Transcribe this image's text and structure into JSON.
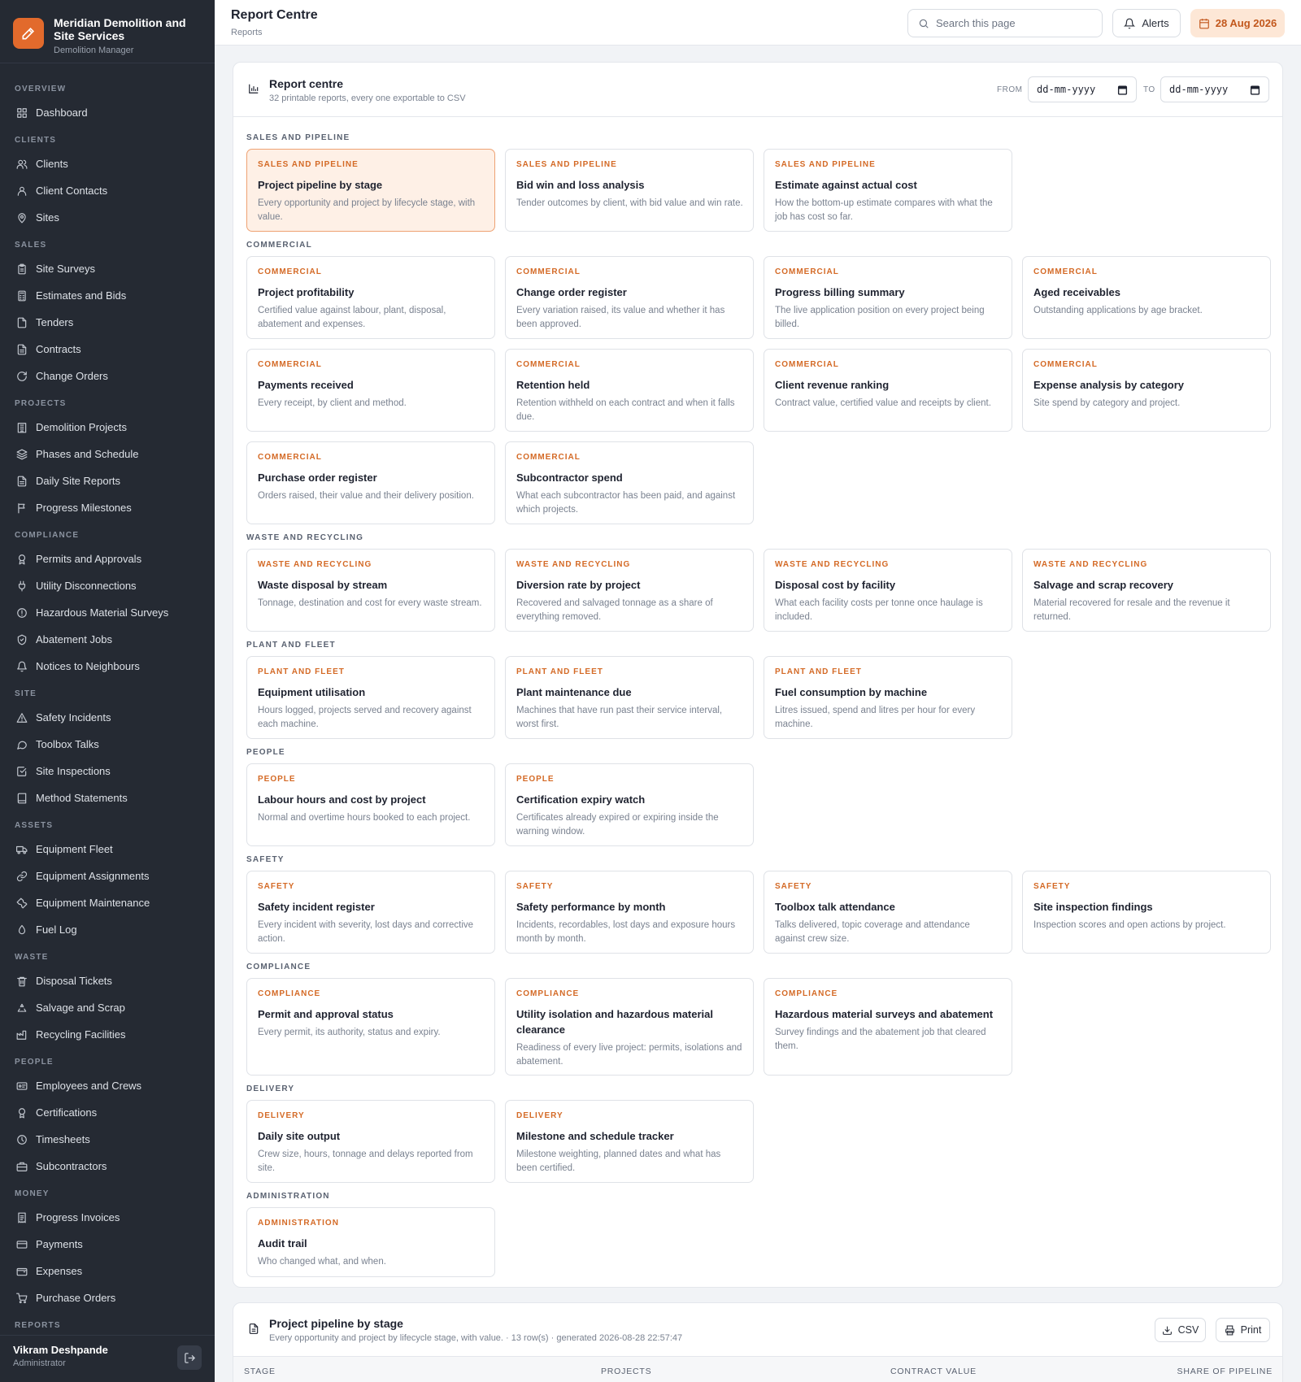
{
  "app": {
    "brand_name": "Meridian Demolition and Site Services",
    "brand_sub": "Demolition Manager"
  },
  "sidebar": {
    "groups": [
      {
        "label": "OVERVIEW",
        "items": [
          {
            "label": "Dashboard",
            "icon": "grid-icon"
          }
        ]
      },
      {
        "label": "CLIENTS",
        "items": [
          {
            "label": "Clients",
            "icon": "users-icon"
          },
          {
            "label": "Client Contacts",
            "icon": "user-icon"
          },
          {
            "label": "Sites",
            "icon": "map-pin-icon"
          }
        ]
      },
      {
        "label": "SALES",
        "items": [
          {
            "label": "Site Surveys",
            "icon": "clipboard-icon"
          },
          {
            "label": "Estimates and Bids",
            "icon": "calculator-icon"
          },
          {
            "label": "Tenders",
            "icon": "file-icon"
          },
          {
            "label": "Contracts",
            "icon": "file-text-icon"
          },
          {
            "label": "Change Orders",
            "icon": "refresh-icon"
          }
        ]
      },
      {
        "label": "PROJECTS",
        "items": [
          {
            "label": "Demolition Projects",
            "icon": "building-icon"
          },
          {
            "label": "Phases and Schedule",
            "icon": "layers-icon"
          },
          {
            "label": "Daily Site Reports",
            "icon": "file-text-icon"
          },
          {
            "label": "Progress Milestones",
            "icon": "flag-icon"
          }
        ]
      },
      {
        "label": "COMPLIANCE",
        "items": [
          {
            "label": "Permits and Approvals",
            "icon": "award-icon"
          },
          {
            "label": "Utility Disconnections",
            "icon": "plug-icon"
          },
          {
            "label": "Hazardous Material Surveys",
            "icon": "alert-circle-icon"
          },
          {
            "label": "Abatement Jobs",
            "icon": "shield-icon"
          },
          {
            "label": "Notices to Neighbours",
            "icon": "bell-icon"
          }
        ]
      },
      {
        "label": "SITE",
        "items": [
          {
            "label": "Safety Incidents",
            "icon": "alert-triangle-icon"
          },
          {
            "label": "Toolbox Talks",
            "icon": "message-icon"
          },
          {
            "label": "Site Inspections",
            "icon": "check-square-icon"
          },
          {
            "label": "Method Statements",
            "icon": "book-icon"
          }
        ]
      },
      {
        "label": "ASSETS",
        "items": [
          {
            "label": "Equipment Fleet",
            "icon": "truck-icon"
          },
          {
            "label": "Equipment Assignments",
            "icon": "link-icon"
          },
          {
            "label": "Equipment Maintenance",
            "icon": "wrench-icon"
          },
          {
            "label": "Fuel Log",
            "icon": "droplet-icon"
          }
        ]
      },
      {
        "label": "WASTE",
        "items": [
          {
            "label": "Disposal Tickets",
            "icon": "trash-icon"
          },
          {
            "label": "Salvage and Scrap",
            "icon": "recycle-icon"
          },
          {
            "label": "Recycling Facilities",
            "icon": "factory-icon"
          }
        ]
      },
      {
        "label": "PEOPLE",
        "items": [
          {
            "label": "Employees and Crews",
            "icon": "id-card-icon"
          },
          {
            "label": "Certifications",
            "icon": "certificate-icon"
          },
          {
            "label": "Timesheets",
            "icon": "clock-icon"
          },
          {
            "label": "Subcontractors",
            "icon": "briefcase-icon"
          }
        ]
      },
      {
        "label": "MONEY",
        "items": [
          {
            "label": "Progress Invoices",
            "icon": "invoice-icon"
          },
          {
            "label": "Payments",
            "icon": "credit-card-icon"
          },
          {
            "label": "Expenses",
            "icon": "wallet-icon"
          },
          {
            "label": "Purchase Orders",
            "icon": "cart-icon"
          }
        ]
      },
      {
        "label": "REPORTS",
        "items": []
      }
    ],
    "user": {
      "name": "Vikram Deshpande",
      "role": "Administrator"
    }
  },
  "header": {
    "title": "Report Centre",
    "breadcrumb": "Reports",
    "search_placeholder": "Search this page",
    "alerts_label": "Alerts",
    "date": "28 Aug 2026"
  },
  "report_centre": {
    "title": "Report centre",
    "subtitle": "32 printable reports, every one exportable to CSV",
    "from_label": "FROM",
    "to_label": "TO",
    "date_placeholder": "dd-mm-yyyy",
    "sections": [
      {
        "title": "SALES AND PIPELINE",
        "cards": [
          {
            "category": "SALES AND PIPELINE",
            "title": "Project pipeline by stage",
            "desc": "Every opportunity and project by lifecycle stage, with value.",
            "active": true
          },
          {
            "category": "SALES AND PIPELINE",
            "title": "Bid win and loss analysis",
            "desc": "Tender outcomes by client, with bid value and win rate."
          },
          {
            "category": "SALES AND PIPELINE",
            "title": "Estimate against actual cost",
            "desc": "How the bottom-up estimate compares with what the job has cost so far."
          }
        ]
      },
      {
        "title": "COMMERCIAL",
        "cards": [
          {
            "category": "COMMERCIAL",
            "title": "Project profitability",
            "desc": "Certified value against labour, plant, disposal, abatement and expenses."
          },
          {
            "category": "COMMERCIAL",
            "title": "Change order register",
            "desc": "Every variation raised, its value and whether it has been approved."
          },
          {
            "category": "COMMERCIAL",
            "title": "Progress billing summary",
            "desc": "The live application position on every project being billed."
          },
          {
            "category": "COMMERCIAL",
            "title": "Aged receivables",
            "desc": "Outstanding applications by age bracket."
          },
          {
            "category": "COMMERCIAL",
            "title": "Payments received",
            "desc": "Every receipt, by client and method."
          },
          {
            "category": "COMMERCIAL",
            "title": "Retention held",
            "desc": "Retention withheld on each contract and when it falls due."
          },
          {
            "category": "COMMERCIAL",
            "title": "Client revenue ranking",
            "desc": "Contract value, certified value and receipts by client."
          },
          {
            "category": "COMMERCIAL",
            "title": "Expense analysis by category",
            "desc": "Site spend by category and project."
          },
          {
            "category": "COMMERCIAL",
            "title": "Purchase order register",
            "desc": "Orders raised, their value and their delivery position."
          },
          {
            "category": "COMMERCIAL",
            "title": "Subcontractor spend",
            "desc": "What each subcontractor has been paid, and against which projects."
          }
        ]
      },
      {
        "title": "WASTE AND RECYCLING",
        "cards": [
          {
            "category": "WASTE AND RECYCLING",
            "title": "Waste disposal by stream",
            "desc": "Tonnage, destination and cost for every waste stream."
          },
          {
            "category": "WASTE AND RECYCLING",
            "title": "Diversion rate by project",
            "desc": "Recovered and salvaged tonnage as a share of everything removed."
          },
          {
            "category": "WASTE AND RECYCLING",
            "title": "Disposal cost by facility",
            "desc": "What each facility costs per tonne once haulage is included."
          },
          {
            "category": "WASTE AND RECYCLING",
            "title": "Salvage and scrap recovery",
            "desc": "Material recovered for resale and the revenue it returned."
          }
        ]
      },
      {
        "title": "PLANT AND FLEET",
        "cards": [
          {
            "category": "PLANT AND FLEET",
            "title": "Equipment utilisation",
            "desc": "Hours logged, projects served and recovery against each machine."
          },
          {
            "category": "PLANT AND FLEET",
            "title": "Plant maintenance due",
            "desc": "Machines that have run past their service interval, worst first."
          },
          {
            "category": "PLANT AND FLEET",
            "title": "Fuel consumption by machine",
            "desc": "Litres issued, spend and litres per hour for every machine."
          }
        ]
      },
      {
        "title": "PEOPLE",
        "cards": [
          {
            "category": "PEOPLE",
            "title": "Labour hours and cost by project",
            "desc": "Normal and overtime hours booked to each project."
          },
          {
            "category": "PEOPLE",
            "title": "Certification expiry watch",
            "desc": "Certificates already expired or expiring inside the warning window."
          }
        ]
      },
      {
        "title": "SAFETY",
        "cards": [
          {
            "category": "SAFETY",
            "title": "Safety incident register",
            "desc": "Every incident with severity, lost days and corrective action."
          },
          {
            "category": "SAFETY",
            "title": "Safety performance by month",
            "desc": "Incidents, recordables, lost days and exposure hours month by month."
          },
          {
            "category": "SAFETY",
            "title": "Toolbox talk attendance",
            "desc": "Talks delivered, topic coverage and attendance against crew size."
          },
          {
            "category": "SAFETY",
            "title": "Site inspection findings",
            "desc": "Inspection scores and open actions by project."
          }
        ]
      },
      {
        "title": "COMPLIANCE",
        "tall": true,
        "cards": [
          {
            "category": "COMPLIANCE",
            "title": "Permit and approval status",
            "desc": "Every permit, its authority, status and expiry."
          },
          {
            "category": "COMPLIANCE",
            "title": "Utility isolation and hazardous material clearance",
            "desc": "Readiness of every live project: permits, isolations and abatement."
          },
          {
            "category": "COMPLIANCE",
            "title": "Hazardous material surveys and abatement",
            "desc": "Survey findings and the abatement job that cleared them."
          }
        ]
      },
      {
        "title": "DELIVERY",
        "cards": [
          {
            "category": "DELIVERY",
            "title": "Daily site output",
            "desc": "Crew size, hours, tonnage and delays reported from site."
          },
          {
            "category": "DELIVERY",
            "title": "Milestone and schedule tracker",
            "desc": "Milestone weighting, planned dates and what has been certified."
          }
        ]
      },
      {
        "title": "ADMINISTRATION",
        "short": true,
        "cards": [
          {
            "category": "ADMINISTRATION",
            "title": "Audit trail",
            "desc": "Who changed what, and when."
          }
        ]
      }
    ]
  },
  "report_preview": {
    "title": "Project pipeline by stage",
    "subtitle": "Every opportunity and project by lifecycle stage, with value. · 13 row(s) · generated 2026-08-28 22:57:47",
    "csv_label": "CSV",
    "print_label": "Print",
    "columns": [
      "STAGE",
      "PROJECTS",
      "CONTRACT VALUE",
      "SHARE OF PIPELINE"
    ]
  },
  "colors": {
    "accent": "#e26a2c",
    "sidebar_bg": "#252a33",
    "category_text": "#d46a26",
    "active_card_bg": "#fef0e6"
  }
}
